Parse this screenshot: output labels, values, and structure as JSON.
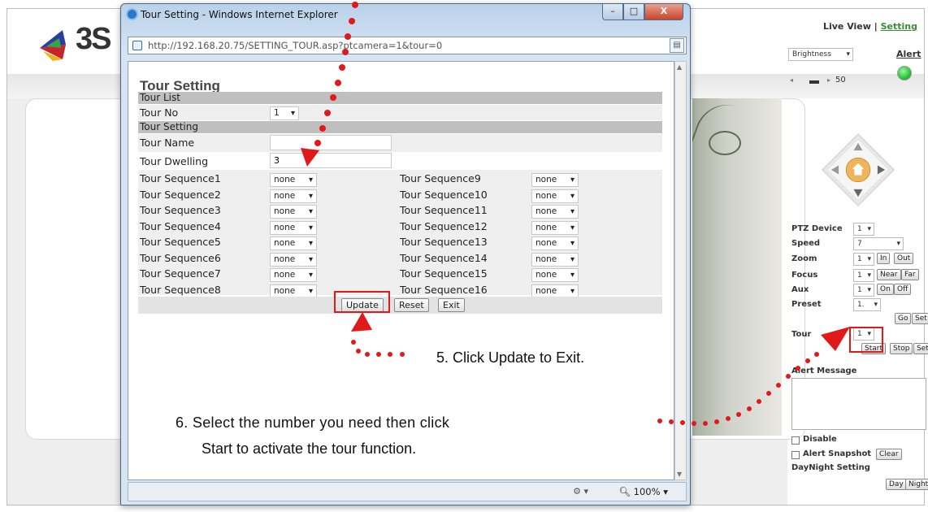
{
  "brand": {
    "logo_text": "3S"
  },
  "nav": {
    "live_view": "Live View",
    "separator": "|",
    "setting": "Setting"
  },
  "top_right": {
    "brightness_select": "Brightness",
    "brightness_value": "50",
    "alert_label": "Alert",
    "alert_color": "#2ecc40"
  },
  "ptz": {
    "device_label": "PTZ Device",
    "device_value": "1",
    "speed_label": "Speed",
    "speed_value": "7",
    "zoom_label": "Zoom",
    "zoom_value": "1",
    "zoom_in": "In",
    "zoom_out": "Out",
    "focus_label": "Focus",
    "focus_value": "1",
    "focus_near": "Near",
    "focus_far": "Far",
    "aux_label": "Aux",
    "aux_value": "1",
    "aux_on": "On",
    "aux_off": "Off",
    "preset_label": "Preset",
    "preset_value": "1.",
    "preset_go": "Go",
    "preset_set": "Set",
    "tour_label": "Tour",
    "tour_value": "1",
    "tour_start": "Start",
    "tour_stop": "Stop",
    "tour_set": "Set"
  },
  "alert_panel": {
    "title": "Alert Message",
    "disable_label": "Disable",
    "snapshot_label": "Alert Snapshot",
    "clear_button": "Clear",
    "daynight_label": "DayNight Setting",
    "day_button": "Day",
    "night_button": "Night"
  },
  "ie_window": {
    "title": "Tour Setting - Windows Internet Explorer",
    "url": "http://192.168.20.75/SETTING_TOUR.asp?ptcamera=1&tour=0",
    "status_zoom": "100%",
    "minimize": "–",
    "maximize": "□",
    "close": "X"
  },
  "form": {
    "title": "Tour Setting",
    "section_tour_list": "Tour List",
    "tour_no_label": "Tour No",
    "tour_no_value": "1",
    "section_tour_setting": "Tour Setting",
    "tour_name_label": "Tour Name",
    "tour_name_value": "",
    "tour_dwelling_label": "Tour Dwelling",
    "tour_dwelling_value": "3",
    "sequences_left": [
      {
        "label": "Tour Sequence1",
        "value": "none"
      },
      {
        "label": "Tour Sequence2",
        "value": "none"
      },
      {
        "label": "Tour Sequence3",
        "value": "none"
      },
      {
        "label": "Tour Sequence4",
        "value": "none"
      },
      {
        "label": "Tour Sequence5",
        "value": "none"
      },
      {
        "label": "Tour Sequence6",
        "value": "none"
      },
      {
        "label": "Tour Sequence7",
        "value": "none"
      },
      {
        "label": "Tour Sequence8",
        "value": "none"
      }
    ],
    "sequences_right": [
      {
        "label": "Tour Sequence9",
        "value": "none"
      },
      {
        "label": "Tour Sequence10",
        "value": "none"
      },
      {
        "label": "Tour Sequence11",
        "value": "none"
      },
      {
        "label": "Tour Sequence12",
        "value": "none"
      },
      {
        "label": "Tour Sequence13",
        "value": "none"
      },
      {
        "label": "Tour Sequence14",
        "value": "none"
      },
      {
        "label": "Tour Sequence15",
        "value": "none"
      },
      {
        "label": "Tour Sequence16",
        "value": "none"
      }
    ],
    "update_button": "Update",
    "reset_button": "Reset",
    "exit_button": "Exit"
  },
  "annotations": {
    "step5": "5. Click Update to Exit.",
    "step6_line1": "6. Select the number you need then click",
    "step6_line2": "Start to activate the tour function.",
    "accent_color": "#e01a1a"
  }
}
